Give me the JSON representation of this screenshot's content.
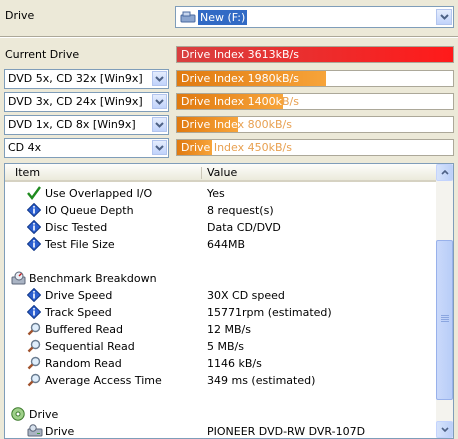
{
  "drive_section": {
    "label": "Drive",
    "selected_drive": "New (F:)"
  },
  "current_drive_label": "Current Drive",
  "speed_rows": [
    {
      "selection": "DVD 5x, CD 32x [Win9x]",
      "bar_text": "Drive Index 3613kB/s",
      "fill_fraction": 1.0,
      "color": "#e8141b"
    },
    {
      "selection": "DVD 5x, CD 32x [Win9x]",
      "bar_text": "Drive Index 1980kB/s",
      "fill_fraction": 0.54,
      "color": "#f08a1c"
    },
    {
      "selection": "DVD 3x, CD 24x [Win9x]",
      "bar_text": "Drive Index 1400kB/s",
      "fill_fraction": 0.385,
      "color": "#f08a1c"
    },
    {
      "selection": "DVD 1x, CD 8x [Win9x]",
      "bar_text": "Drive Index 800kB/s",
      "fill_fraction": 0.22,
      "color": "#f08a1c"
    },
    {
      "selection": "CD 4x",
      "bar_text": "Drive Index 450kB/s",
      "fill_fraction": 0.125,
      "color": "#f08a1c"
    }
  ],
  "list": {
    "columns": [
      "Item",
      "Value"
    ],
    "rows": [
      {
        "icon": "checkmark-icon",
        "item": "Use Overlapped I/O",
        "value": "Yes"
      },
      {
        "icon": "info-diamond-icon",
        "item": "IO Queue Depth",
        "value": "8 request(s)"
      },
      {
        "icon": "info-diamond-icon",
        "item": "Disc Tested",
        "value": "Data CD/DVD"
      },
      {
        "icon": "info-diamond-icon",
        "item": "Test File Size",
        "value": "644MB"
      },
      {
        "icon": "",
        "item": "",
        "value": ""
      },
      {
        "icon": "benchmark-icon",
        "item": "Benchmark Breakdown",
        "value": ""
      },
      {
        "icon": "info-diamond-icon",
        "item": "Drive Speed",
        "value": "30X CD speed"
      },
      {
        "icon": "info-diamond-icon",
        "item": "Track Speed",
        "value": "15771rpm (estimated)"
      },
      {
        "icon": "magnifier-icon",
        "item": "Buffered Read",
        "value": "12 MB/s"
      },
      {
        "icon": "magnifier-icon",
        "item": "Sequential Read",
        "value": "5 MB/s"
      },
      {
        "icon": "magnifier-icon",
        "item": "Random Read",
        "value": "1146 kB/s"
      },
      {
        "icon": "magnifier-icon",
        "item": "Average Access Time",
        "value": "349 ms (estimated)"
      },
      {
        "icon": "",
        "item": "",
        "value": ""
      },
      {
        "icon": "disc-icon",
        "item": "Drive",
        "value": ""
      },
      {
        "icon": "drive-icon",
        "item": "Drive",
        "value": "PIONEER DVD-RW  DVR-107D"
      }
    ]
  }
}
